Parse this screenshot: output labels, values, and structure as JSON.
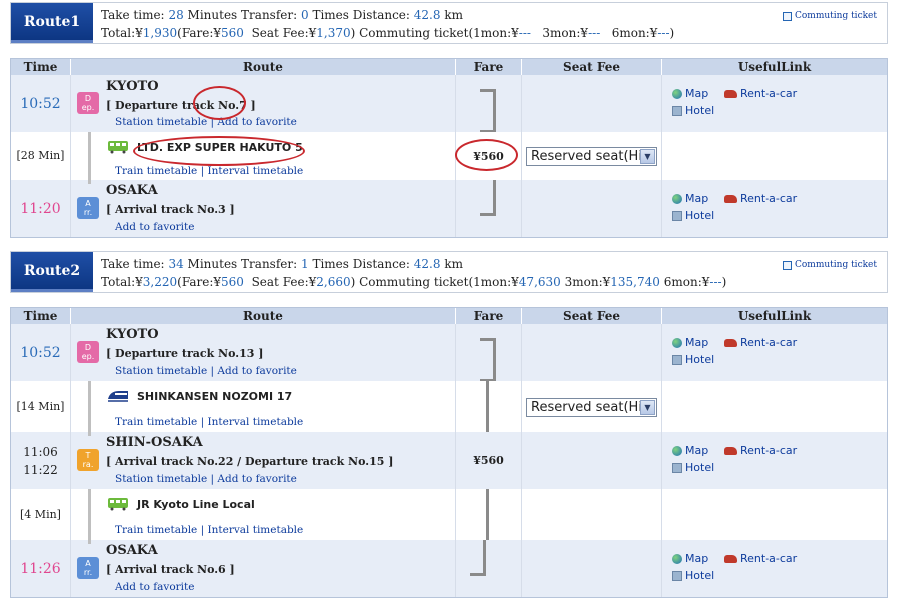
{
  "routes": [
    {
      "label": "Route1",
      "summary": {
        "take_time_label": "Take time:",
        "take_time": "28",
        "minutes_label": "Minutes",
        "transfer_label": "Transfer:",
        "transfer": "0",
        "times_label": "Times",
        "distance_label": "Distance:",
        "distance": "42.8",
        "km_label": "km",
        "total_label": "Total:¥",
        "total": "1,930",
        "fare_label": "(Fare:¥",
        "fare": "560",
        "seat_fee_label": "Seat Fee:¥",
        "seat_fee": "1,370",
        "commuting_label": ") Commuting ticket(1mon:¥",
        "mon1": "---",
        "mon3_label": "3mon:¥",
        "mon3": "---",
        "mon6_label": "6mon:¥",
        "mon6": "---",
        "close_paren": ")"
      },
      "commuting_link": "Commuting ticket"
    },
    {
      "label": "Route2",
      "summary": {
        "take_time_label": "Take time:",
        "take_time": "34",
        "minutes_label": "Minutes",
        "transfer_label": "Transfer:",
        "transfer": "1",
        "times_label": "Times",
        "distance_label": "Distance:",
        "distance": "42.8",
        "km_label": "km",
        "total_label": "Total:¥",
        "total": "3,220",
        "fare_label": "(Fare:¥",
        "fare": "560",
        "seat_fee_label": "Seat Fee:¥",
        "seat_fee": "2,660",
        "commuting_label": ") Commuting ticket(1mon:¥",
        "mon1": "47,630",
        "mon3_label": "3mon:¥",
        "mon3": "135,740",
        "mon6_label": "6mon:¥",
        "mon6": "---",
        "close_paren": ")"
      },
      "commuting_link": "Commuting ticket"
    }
  ],
  "table_headers": [
    "Time",
    "Route",
    "Fare",
    "Seat Fee",
    "UsefulLink"
  ],
  "links": {
    "map": "Map",
    "rent": "Rent-a-car",
    "hotel": "Hotel"
  },
  "badges": {
    "dep": [
      "D",
      "ep."
    ],
    "arr": [
      "A",
      "rr."
    ],
    "tra": [
      "T",
      "ra."
    ]
  },
  "r1": {
    "dep_time": "10:52",
    "dep_station": "KYOTO",
    "dep_track": "[ Departure track No.7 ]",
    "dep_links": "Station timetable | Add to favorite",
    "dur": "[28 Min]",
    "train": "LTD. EXP SUPER HAKUTO 5",
    "train_links": "Train timetable | Interval timetable",
    "fare": "¥560",
    "seat_select": "Reserved seat(Hi",
    "arr_time": "11:20",
    "arr_station": "OSAKA",
    "arr_track": "[ Arrival track No.3 ]",
    "arr_links": "Add to favorite"
  },
  "r2": {
    "dep_time": "10:52",
    "dep_station": "KYOTO",
    "dep_track": "[ Departure track No.13 ]",
    "dep_links": "Station timetable | Add to favorite",
    "dur1": "[14 Min]",
    "train1": "SHINKANSEN NOZOMI 17",
    "train1_links": "Train timetable | Interval timetable",
    "seat_select": "Reserved seat(Hi",
    "tra_time1": "11:06",
    "tra_time2": "11:22",
    "tra_station": "SHIN-OSAKA",
    "tra_track": "[ Arrival track No.22 / Departure track No.15 ]",
    "tra_links": "Station timetable | Add to favorite",
    "fare": "¥560",
    "dur2": "[4 Min]",
    "train2": "JR Kyoto Line Local",
    "train2_links": "Train timetable | Interval timetable",
    "arr_time": "11:26",
    "arr_station": "OSAKA",
    "arr_track": "[ Arrival track No.6 ]",
    "arr_links": "Add to favorite"
  }
}
